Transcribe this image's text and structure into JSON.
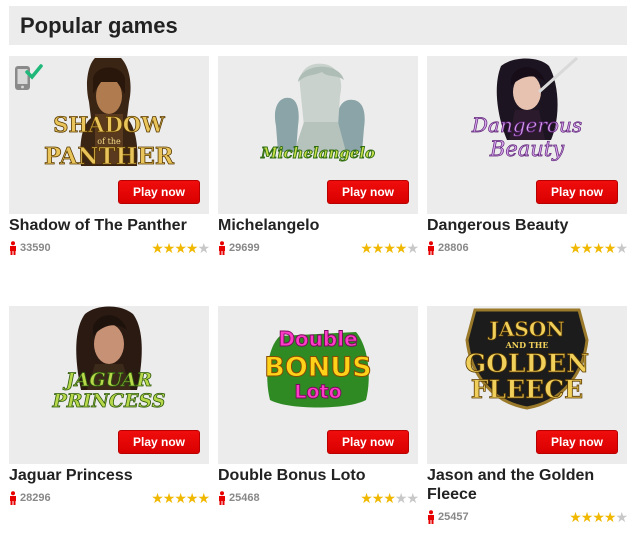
{
  "section": {
    "title": "Popular games"
  },
  "play_label": "Play now",
  "colors": {
    "accent": "#e60000",
    "star": "#f0b800",
    "panel": "#ececec"
  },
  "games": [
    {
      "title": "Shadow of The Panther",
      "logo": "SHADOW",
      "logo_sub": "of the",
      "logo2": "PANTHER",
      "players": "33590",
      "rating": 4,
      "mobile": true
    },
    {
      "title": "Michelangelo",
      "logo": "Michelangelo",
      "players": "29699",
      "rating": 4,
      "mobile": false
    },
    {
      "title": "Dangerous Beauty",
      "logo": "Dangerous",
      "logo2": "Beauty",
      "players": "28806",
      "rating": 4,
      "mobile": false
    },
    {
      "title": "Jaguar Princess",
      "logo": "JAGUAR",
      "logo2": "PRINCESS",
      "players": "28296",
      "rating": 5,
      "mobile": false
    },
    {
      "title": "Double Bonus Loto",
      "logo": "Double",
      "logo2": "BONUS",
      "logo3": "Loto",
      "players": "25468",
      "rating": 3,
      "mobile": false
    },
    {
      "title": "Jason and the Golden Fleece",
      "logo": "JASON",
      "logo_sub": "AND THE",
      "logo2": "GOLDEN",
      "logo3": "FLEECE",
      "players": "25457",
      "rating": 4,
      "mobile": false
    }
  ]
}
